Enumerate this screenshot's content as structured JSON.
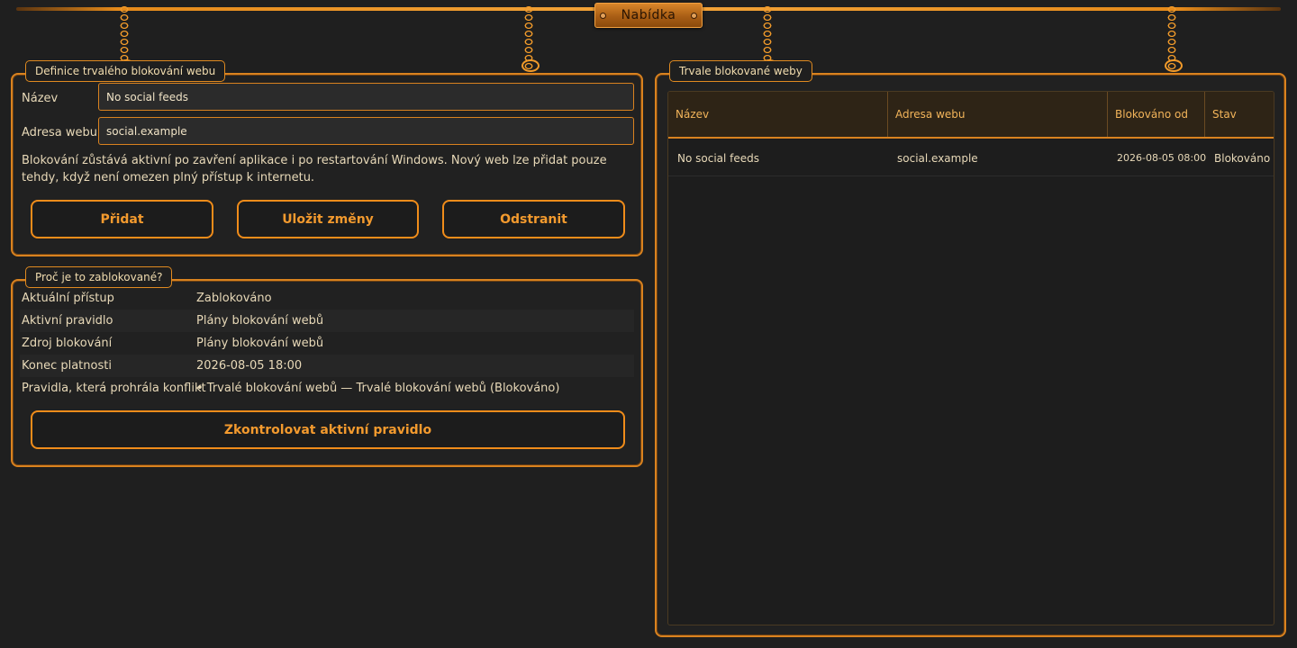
{
  "menu": {
    "label": "Nabídka"
  },
  "definition": {
    "title": "Definice trvalého blokování webu",
    "name_label": "Název",
    "name_value": "No social feeds",
    "address_label": "Adresa webu",
    "address_value": "social.example",
    "info": "Blokování zůstává aktivní po zavření aplikace i po restartování Windows. Nový web lze přidat pouze tehdy, když není omezen plný přístup k internetu.",
    "buttons": {
      "add": "Přidat",
      "save": "Uložit změny",
      "remove": "Odstranit"
    }
  },
  "why": {
    "title": "Proč je to zablokované?",
    "rows": [
      {
        "key": "Aktuální přístup",
        "value": "Zablokováno"
      },
      {
        "key": "Aktivní pravidlo",
        "value": "Plány blokování webů"
      },
      {
        "key": "Zdroj blokování",
        "value": "Plány blokování webů"
      },
      {
        "key": "Konec platnosti",
        "value": "2026-08-05 18:00"
      },
      {
        "key": "Pravidla, která prohrála konflikt",
        "value": "• Trvalé blokování webů — Trvalé blokování webů (Blokováno)"
      }
    ],
    "check_button": "Zkontrolovat aktivní pravidlo"
  },
  "blocked": {
    "title": "Trvale blokované weby",
    "columns": [
      "Název",
      "Adresa webu",
      "Blokováno od",
      "Stav"
    ],
    "rows": [
      [
        "No social feeds",
        "social.example",
        "2026-08-05 08:00",
        "Blokováno"
      ]
    ]
  },
  "colors": {
    "accent": "#f08c1a",
    "background": "#1f1f1f",
    "text": "#e8d9b8"
  }
}
